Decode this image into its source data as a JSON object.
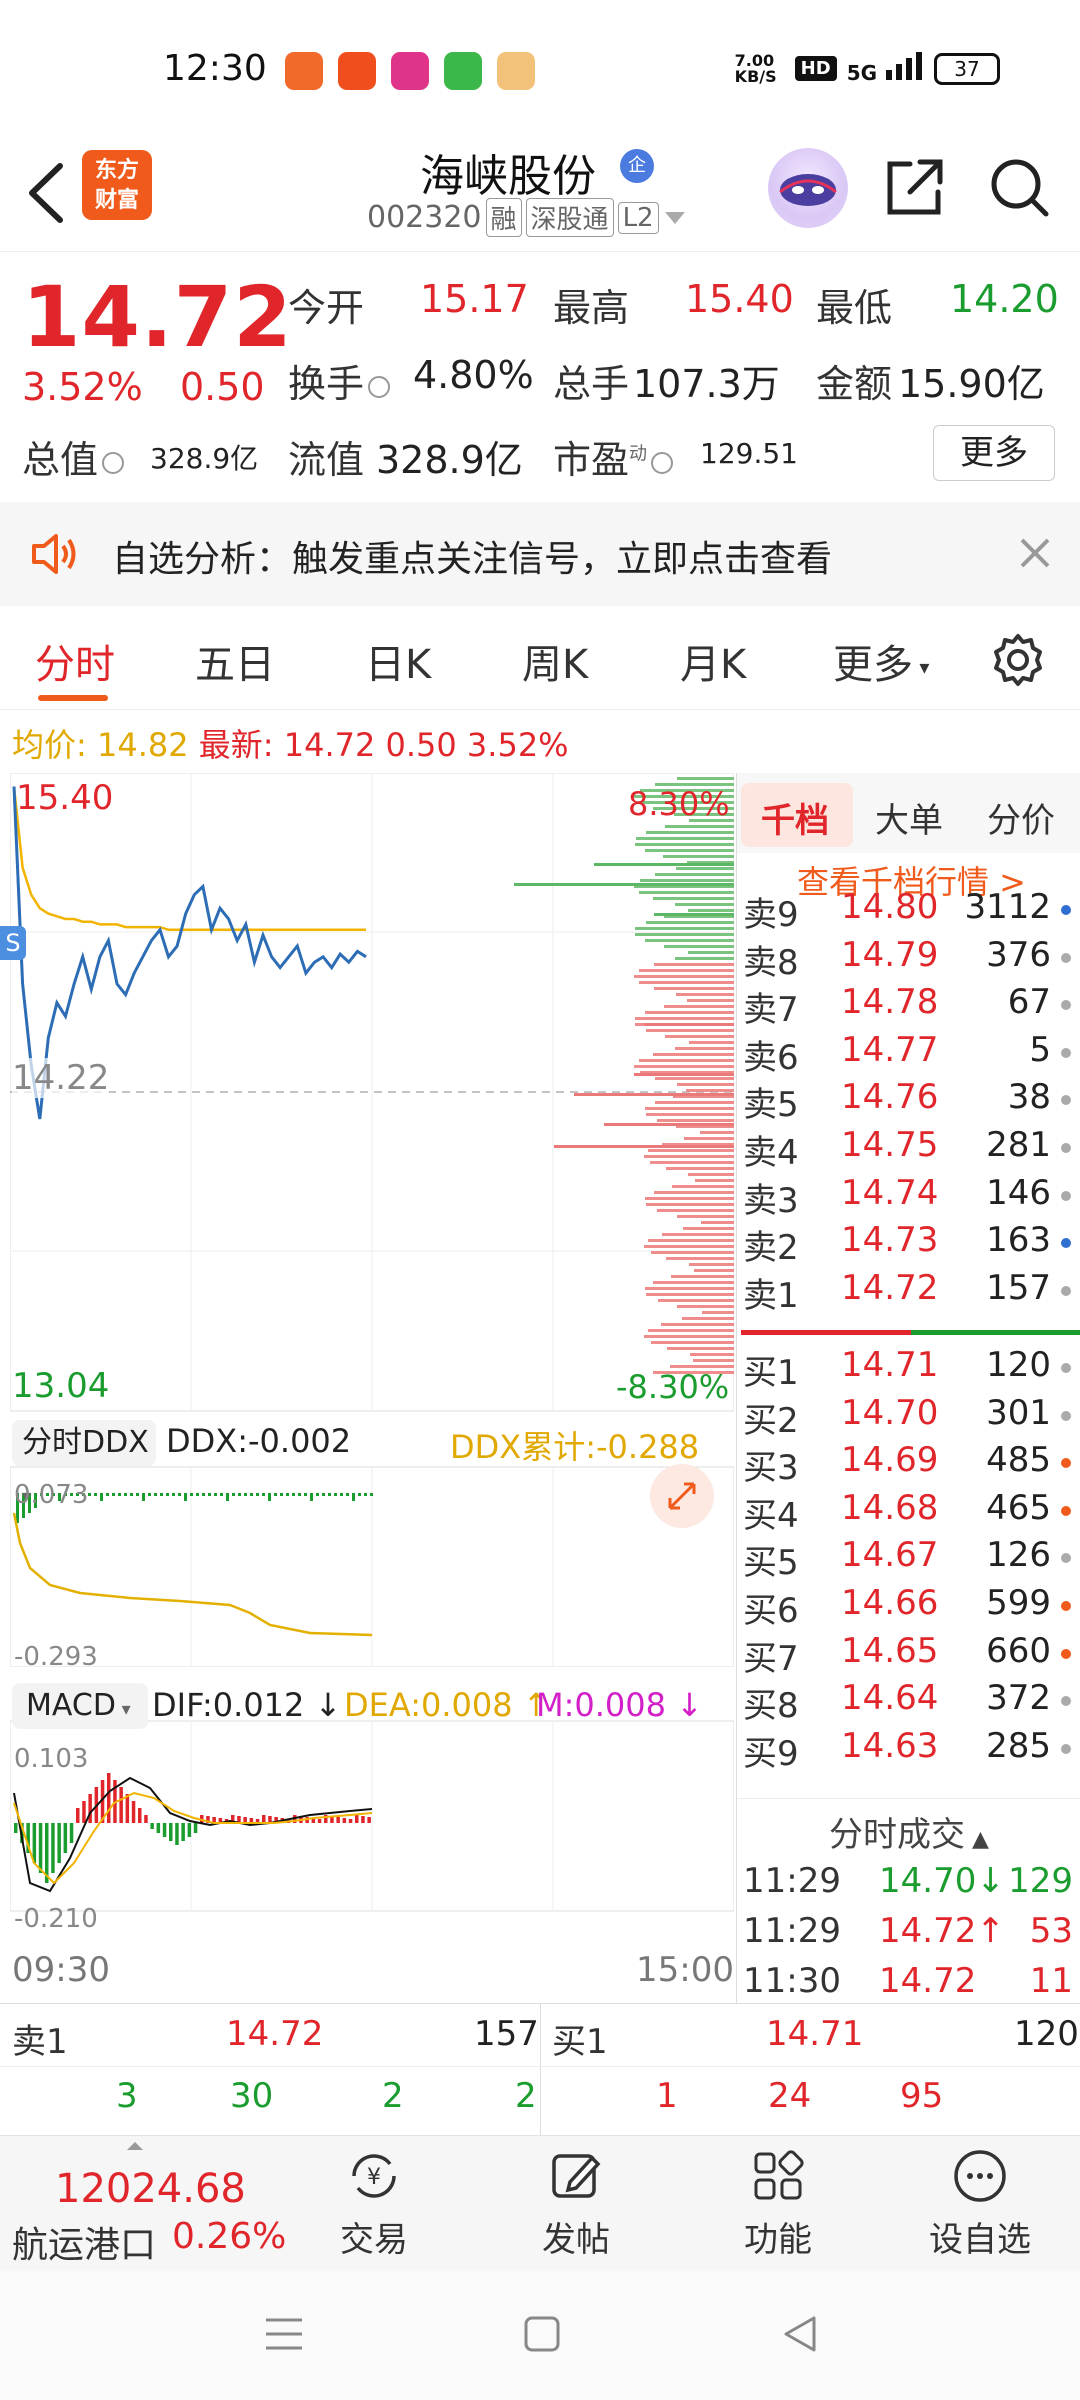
{
  "status_bar": {
    "time": "12:30",
    "net_speed": "7.00 KB/S",
    "hd": "HD",
    "network": "5G",
    "battery": "37"
  },
  "header": {
    "logo_line1": "东方",
    "logo_line2": "财富",
    "stock_name": "海峡股份",
    "badge": "企",
    "stock_code": "002320",
    "tag_margin": "融",
    "tag_connect": "深股通",
    "tag_level": "L2"
  },
  "quote": {
    "last_price": "14.72",
    "change_pct": "3.52%",
    "change_amt": "0.50",
    "open_label": "今开",
    "open_value": "15.17",
    "high_label": "最高",
    "high_value": "15.40",
    "low_label": "最低",
    "low_value": "14.20",
    "turnover_label": "换手",
    "turnover_value": "4.80%",
    "volume_label": "总手",
    "volume_value": "107.3万",
    "amount_label": "金额",
    "amount_value": "15.90亿",
    "mcap_label": "总值",
    "mcap_value": "328.9亿",
    "float_label": "流值",
    "float_value": "328.9亿",
    "pe_label": "市盈",
    "pe_sup": "动",
    "pe_value": "129.51",
    "more_label": "更多"
  },
  "alert": {
    "text": "自选分析：触发重点关注信号，立即点击查看"
  },
  "tabs": [
    "分时",
    "五日",
    "日K",
    "周K",
    "月K",
    "更多"
  ],
  "summary": {
    "avg_label": "均价:",
    "avg_value": "14.82",
    "latest_label": "最新:",
    "latest_value": "14.72",
    "chg": "0.50",
    "pct": "3.52%"
  },
  "chart_labels": {
    "y_high": "15.40",
    "y_mid": "14.22",
    "y_low": "13.04",
    "pct_high": "8.30%",
    "pct_low": "-8.30%",
    "ddx_selector": "分时DDX",
    "ddx_value": "DDX:-0.002",
    "ddx_cum": "DDX累计:-0.288",
    "ddx_max": "0.073",
    "ddx_min": "-0.293",
    "macd_selector": "MACD",
    "dif": "DIF:0.012",
    "dea": "DEA:0.008",
    "m": "M:0.008",
    "macd_max": "0.103",
    "macd_min": "-0.210",
    "time_start": "09:30",
    "time_end": "15:00",
    "s_marker": "S"
  },
  "chart_data": {
    "type": "line",
    "ylim": [
      13.04,
      15.4
    ],
    "series": [
      {
        "values": [
          15.35,
          14.62,
          14.32,
          14.12,
          14.42,
          14.55,
          14.5,
          14.62,
          14.72,
          14.6,
          14.72,
          14.78,
          14.62,
          14.58,
          14.66,
          14.72,
          14.78,
          14.82,
          14.72,
          14.76,
          14.88,
          14.95,
          14.98,
          14.82,
          14.9,
          14.86,
          14.78,
          14.84,
          14.7,
          14.8,
          14.72,
          14.68,
          14.72,
          14.76,
          14.66,
          14.7,
          14.72,
          14.68,
          14.73,
          14.7,
          14.74,
          14.72
        ]
      },
      {
        "values": [
          15.35,
          15.05,
          14.95,
          14.9,
          14.88,
          14.87,
          14.86,
          14.86,
          14.85,
          14.85,
          14.84,
          14.84,
          14.84,
          14.83,
          14.83,
          14.83,
          14.83,
          14.83,
          14.82,
          14.82,
          14.82,
          14.82,
          14.82,
          14.82,
          14.82,
          14.82,
          14.82,
          14.82,
          14.82,
          14.82,
          14.82,
          14.82,
          14.82,
          14.82,
          14.82,
          14.82,
          14.82,
          14.82,
          14.82,
          14.82,
          14.82,
          14.82
        ]
      }
    ]
  },
  "orderbook": {
    "tabs": [
      "千档",
      "大单",
      "分价"
    ],
    "link": "查看千档行情 >",
    "asks": [
      {
        "label": "卖9",
        "price": "14.80",
        "vol": "3112",
        "dot": "#2e6fd1"
      },
      {
        "label": "卖8",
        "price": "14.79",
        "vol": "376",
        "dot": "#aaaaaa"
      },
      {
        "label": "卖7",
        "price": "14.78",
        "vol": "67",
        "dot": "#aaaaaa"
      },
      {
        "label": "卖6",
        "price": "14.77",
        "vol": "5",
        "dot": "#aaaaaa"
      },
      {
        "label": "卖5",
        "price": "14.76",
        "vol": "38",
        "dot": "#aaaaaa"
      },
      {
        "label": "卖4",
        "price": "14.75",
        "vol": "281",
        "dot": "#aaaaaa"
      },
      {
        "label": "卖3",
        "price": "14.74",
        "vol": "146",
        "dot": "#aaaaaa"
      },
      {
        "label": "卖2",
        "price": "14.73",
        "vol": "163",
        "dot": "#2e6fd1"
      },
      {
        "label": "卖1",
        "price": "14.72",
        "vol": "157",
        "dot": "#aaaaaa"
      }
    ],
    "bids": [
      {
        "label": "买1",
        "price": "14.71",
        "vol": "120",
        "dot": "#aaaaaa"
      },
      {
        "label": "买2",
        "price": "14.70",
        "vol": "301",
        "dot": "#aaaaaa"
      },
      {
        "label": "买3",
        "price": "14.69",
        "vol": "485",
        "dot": "#f05a1a"
      },
      {
        "label": "买4",
        "price": "14.68",
        "vol": "465",
        "dot": "#f05a1a"
      },
      {
        "label": "买5",
        "price": "14.67",
        "vol": "126",
        "dot": "#aaaaaa"
      },
      {
        "label": "买6",
        "price": "14.66",
        "vol": "599",
        "dot": "#f05a1a"
      },
      {
        "label": "买7",
        "price": "14.65",
        "vol": "660",
        "dot": "#f05a1a"
      },
      {
        "label": "买8",
        "price": "14.64",
        "vol": "372",
        "dot": "#aaaaaa"
      },
      {
        "label": "买9",
        "price": "14.63",
        "vol": "285",
        "dot": "#aaaaaa"
      }
    ],
    "ticks_header": "分时成交",
    "ticks": [
      {
        "time": "11:29",
        "price": "14.70↓",
        "vol": "129",
        "color": "green"
      },
      {
        "time": "11:29",
        "price": "14.72↑",
        "vol": "53",
        "color": "red"
      },
      {
        "time": "11:30",
        "price": "14.72",
        "vol": "11",
        "color": "red"
      }
    ]
  },
  "strip": {
    "ask_label": "卖1",
    "ask_price": "14.72",
    "ask_vol": "157",
    "bid_label": "买1",
    "bid_price": "14.71",
    "bid_vol": "120",
    "row2": [
      "3",
      "30",
      "2",
      "2",
      "1",
      "24",
      "95"
    ]
  },
  "bottom_nav": {
    "index_value": "12024.68",
    "index_name": "航运港口",
    "index_pct": "0.26%",
    "items": [
      "交易",
      "发帖",
      "功能",
      "设自选"
    ]
  }
}
